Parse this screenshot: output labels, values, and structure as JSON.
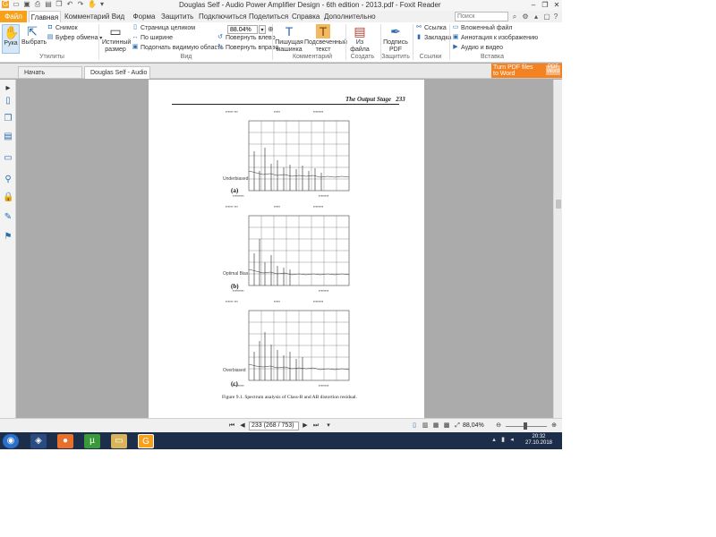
{
  "window": {
    "title": "Douglas Self - Audio Power Amplifier Design - 6th edition - 2013.pdf - Foxit Reader"
  },
  "tabs": {
    "file": "Файл",
    "home": "Главная",
    "comment": "Комментарий",
    "view": "Вид",
    "form": "Форма",
    "protect": "Защитить",
    "connect": "Подключиться",
    "share": "Поделиться",
    "help": "Справка",
    "more": "Дополнительно"
  },
  "search": {
    "placeholder": "Поиск"
  },
  "ribbon": {
    "hand": "Рука",
    "select": "Выбрать",
    "snapshot": "Снимок",
    "clipboard": "Буфер обмена",
    "tools_label": "Утилиты",
    "actual_size_1": "Истинный",
    "actual_size_2": "размер",
    "fit_page": "Страница целиком",
    "fit_width": "По ширине",
    "fit_visible": "Подогнать видимую область",
    "zoom_value": "88.04%",
    "rotate_left": "Повернуть влево",
    "rotate_right": "Повернуть вправо",
    "view_label": "Вид",
    "typewriter_1": "Пишущая",
    "typewriter_2": "машинка",
    "highlight_1": "Подсвеченный",
    "highlight_2": "текст",
    "comment_label": "Комментарий",
    "from_file_1": "Из",
    "from_file_2": "файла",
    "create_label": "Создать",
    "sign_1": "Подпись",
    "sign_2": "PDF",
    "protect_label": "Защитить",
    "link": "Ссылка",
    "bookmark": "Закладка",
    "links_label": "Ссылки",
    "attachment": "Вложенный файл",
    "image_annot": "Аннотация к изображению",
    "audio_video": "Аудио и видео",
    "insert_label": "Вставка"
  },
  "doctabs": {
    "start": "Начать",
    "doc": "Douglas Self - Audio Po..."
  },
  "banner": {
    "line1": "Turn PDF files",
    "line2": "to Word",
    "badge": "PDF Word"
  },
  "page": {
    "running_head": "The Output Stage",
    "page_number": "233",
    "caption": "Figure 9.1. Spectrum analysis of Class-B and AB distortion residual.",
    "panels": [
      {
        "letter": "(a)",
        "label": "Underbiased"
      },
      {
        "letter": "(b)",
        "label": "Optimal Bias"
      },
      {
        "letter": "(c)",
        "label": "Overbiased"
      }
    ]
  },
  "statusbar": {
    "page_field": "233 (268 / 753)",
    "zoom": "88,04%"
  },
  "taskbar": {
    "time": "20:32",
    "date": "27.10.2018"
  }
}
